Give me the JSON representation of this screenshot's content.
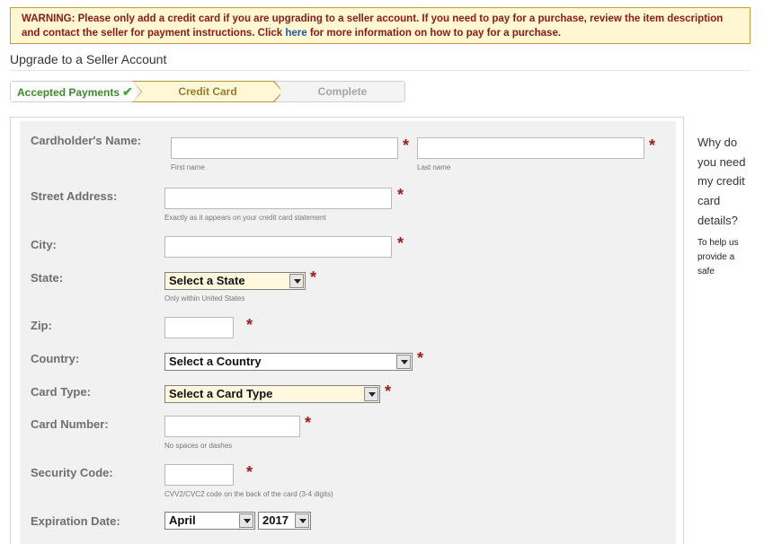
{
  "warning": {
    "prefix": "WARNING: Please only add a credit card if you are upgrading to a seller account. If you need to pay for a purchase, review the item description and contact the seller for payment instructions. Click ",
    "link": "here",
    "suffix": " for more information on how to pay for a purchase."
  },
  "page_title": "Upgrade to a Seller Account",
  "steps": [
    "Accepted Payments",
    "Credit Card",
    "Complete"
  ],
  "form": {
    "cardholder_label": "Cardholder's Name:",
    "first_name_hint": "First name",
    "last_name_hint": "Last name",
    "street_label": "Street Address:",
    "street_hint": "Exactly as it appears on your credit card statement",
    "city_label": "City:",
    "state_label": "State:",
    "state_value": "Select a State",
    "state_hint": "Only within United States",
    "zip_label": "Zip:",
    "country_label": "Country:",
    "country_value": "Select a Country",
    "card_type_label": "Card Type:",
    "card_type_value": "Select a Card Type",
    "card_number_label": "Card Number:",
    "card_number_hint": "No spaces or dashes",
    "security_label": "Security Code:",
    "security_hint": "CVV2/CVC2 code on the back of the card (3-4 digits)",
    "expiration_label": "Expiration Date:",
    "exp_month": "April",
    "exp_year": "2017",
    "required_mark": "*"
  },
  "sidebar": {
    "question": "Why do you need my credit card details?",
    "answer": "To help us provide a safe"
  },
  "colors": {
    "warning_bg": "#fff7d1",
    "warning_text": "#8b1a1a",
    "link": "#2357a3",
    "required": "#9b1c1c",
    "active_step_bg": "#fff8d6",
    "done_step": "#3a8d2a"
  },
  "icons": {
    "step_done": "checkmark-icon",
    "dropdown": "chevron-down-icon"
  }
}
